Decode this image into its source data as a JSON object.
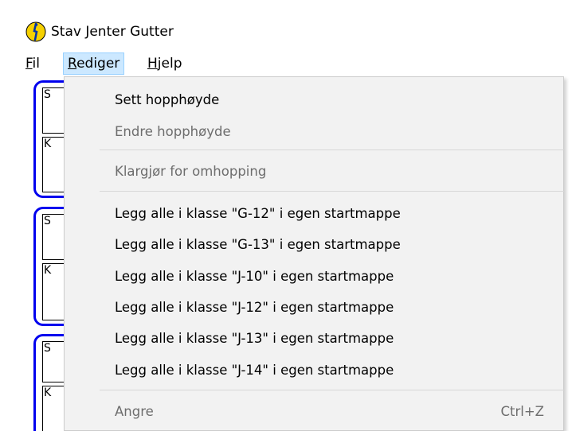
{
  "window": {
    "title": "Stav Jenter Gutter"
  },
  "menubar": {
    "fil": {
      "mnemonic": "F",
      "rest": "il"
    },
    "rediger": {
      "mnemonic": "R",
      "rest": "ediger"
    },
    "hjelp": {
      "mnemonic": "H",
      "rest": "jelp"
    }
  },
  "background_groups": [
    {
      "box1": "S",
      "box2": "K"
    },
    {
      "box1": "S",
      "box2": "K"
    },
    {
      "box1": "S",
      "box2": "K"
    }
  ],
  "dropdown": {
    "items": [
      {
        "label": "Sett hopphøyde",
        "enabled": true
      },
      {
        "label": "Endre hopphøyde",
        "enabled": false
      },
      {
        "label": "Klargjør for omhopping",
        "enabled": false
      },
      {
        "label": "Legg alle i klasse \"G-12\" i egen startmappe",
        "enabled": true
      },
      {
        "label": "Legg alle i klasse \"G-13\" i egen startmappe",
        "enabled": true
      },
      {
        "label": "Legg alle i klasse \"J-10\" i egen startmappe",
        "enabled": true
      },
      {
        "label": "Legg alle i klasse \"J-12\" i egen startmappe",
        "enabled": true
      },
      {
        "label": "Legg alle i klasse \"J-13\" i egen startmappe",
        "enabled": true
      },
      {
        "label": "Legg alle i klasse \"J-14\" i egen startmappe",
        "enabled": true
      },
      {
        "label": "Angre",
        "enabled": false,
        "shortcut": "Ctrl+Z"
      }
    ]
  },
  "icons": {
    "app": "athlete-app-icon"
  },
  "colors": {
    "menu_highlight": "#cce8ff",
    "group_border": "#0000ee",
    "disabled_text": "#6d6d6d"
  }
}
